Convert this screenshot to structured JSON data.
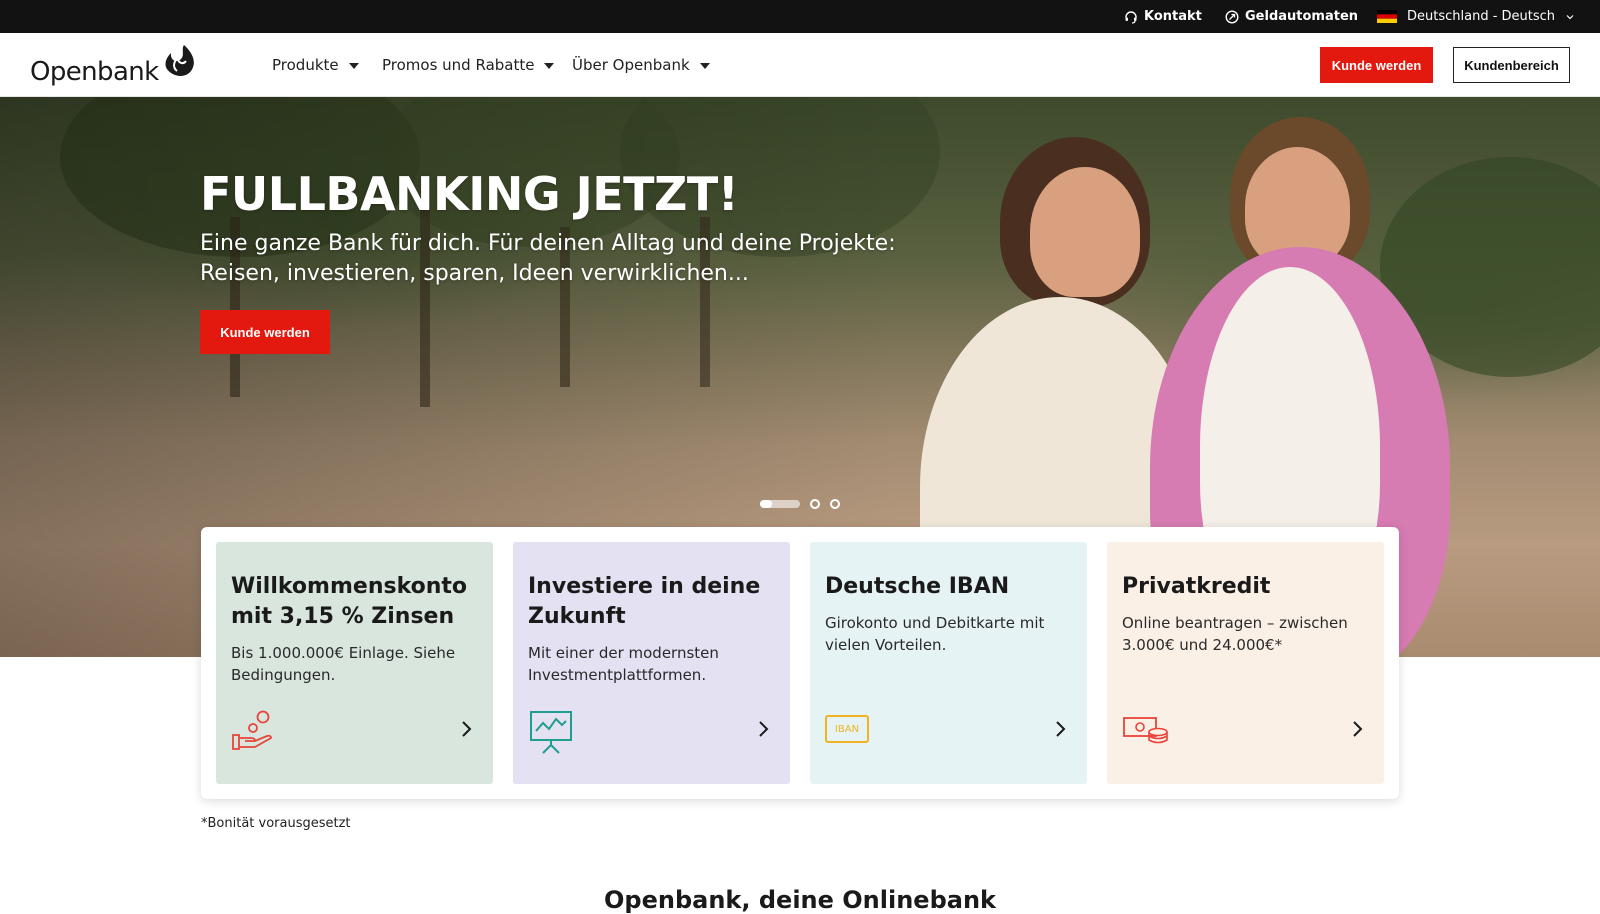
{
  "topbar": {
    "contact": "Kontakt",
    "atm": "Geldautomaten",
    "language": "Deutschland - Deutsch"
  },
  "header": {
    "logo_text": "Openbank",
    "nav": [
      {
        "label": "Produkte"
      },
      {
        "label": "Promos und Rabatte"
      },
      {
        "label": "Über Openbank"
      }
    ],
    "cta_primary": "Kunde werden",
    "cta_secondary": "Kundenbereich"
  },
  "hero": {
    "title": "FULLBANKING JETZT!",
    "subtitle_line1": "Eine ganze Bank für dich. Für deinen Alltag und deine Projekte:",
    "subtitle_line2": "Reisen, investieren, sparen, Ideen verwirklichen...",
    "cta": "Kunde werden",
    "slides_total": 3,
    "slide_active": 1
  },
  "cards": [
    {
      "title": "Willkommenskonto mit 3,15 % Zinsen",
      "text": "Bis 1.000.000€ Einlage. Siehe Bedingungen.",
      "icon": "coin-hand-icon",
      "bg": "#d8e6dd"
    },
    {
      "title": "Investiere in deine Zukunft",
      "text": "Mit einer der modernsten Investmentplattformen.",
      "icon": "chart-board-icon",
      "bg": "#e4e1f2"
    },
    {
      "title": "Deutsche IBAN",
      "text": "Girokonto und Debitkarte mit vielen Vorteilen.",
      "icon": "iban-card-icon",
      "bg": "#e6f3f5",
      "icon_label": "IBAN"
    },
    {
      "title": "Privatkredit",
      "text": "Online beantragen – zwischen 3.000€ und 24.000€*",
      "icon": "money-stack-icon",
      "bg": "#faf0e6"
    }
  ],
  "footnote": "*Bonität vorausgesetzt",
  "next_section_heading": "Openbank, deine Onlinebank",
  "colors": {
    "brand_red": "#e3190f",
    "topbar_bg": "#121212"
  }
}
